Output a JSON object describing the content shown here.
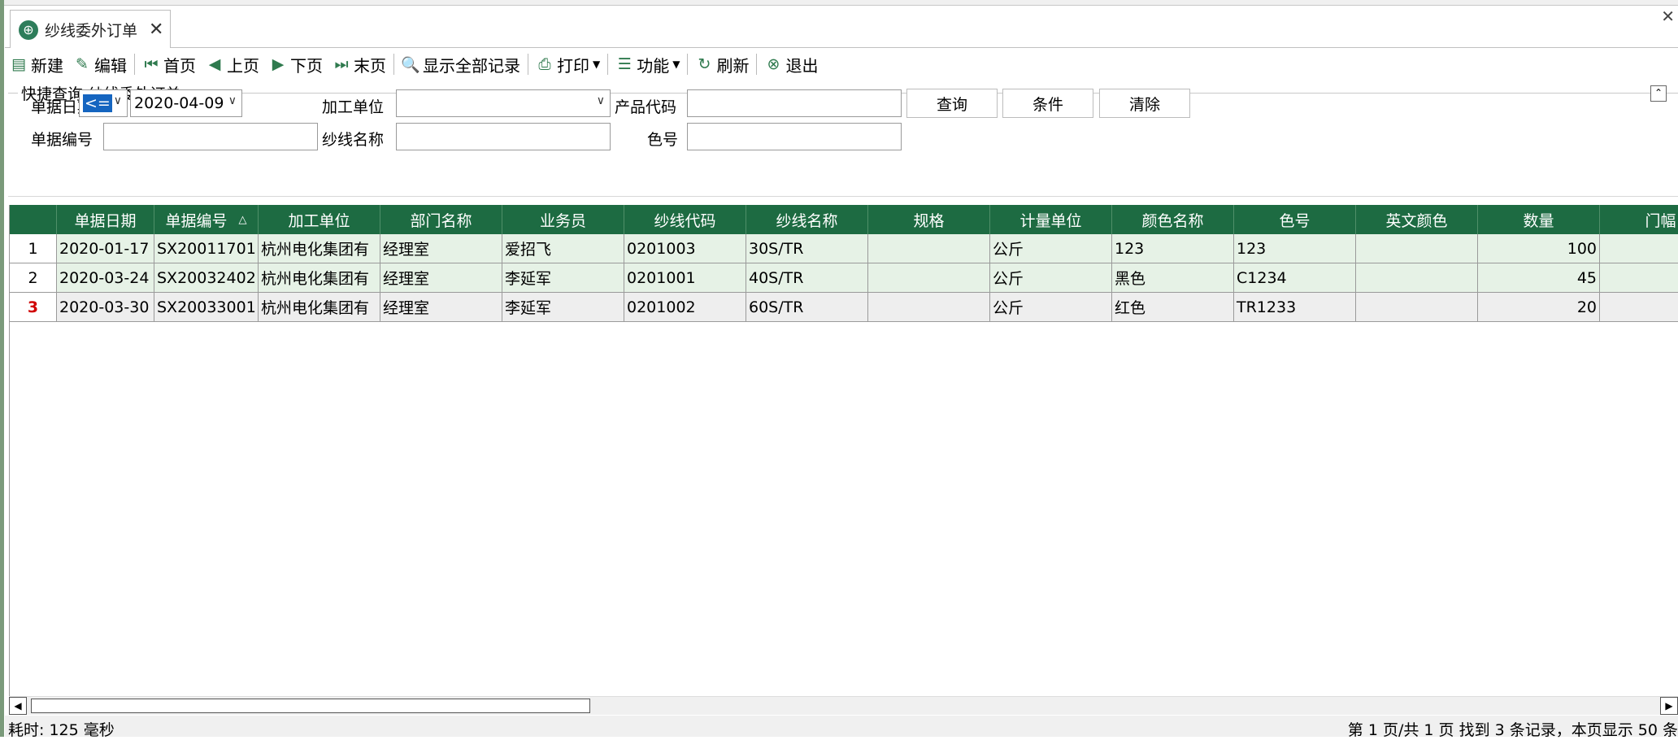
{
  "tab": {
    "title": "纱线委外订单",
    "close": "✕"
  },
  "window_close": "✕",
  "toolbar": [
    {
      "name": "new-button",
      "icon": "▤",
      "label": "新建"
    },
    {
      "name": "edit-button",
      "icon": "✎",
      "label": "编辑"
    },
    {
      "name": "first-page-button",
      "icon": "⏮",
      "label": "首页"
    },
    {
      "name": "prev-page-button",
      "icon": "◀",
      "label": "上页"
    },
    {
      "name": "next-page-button",
      "icon": "▶",
      "label": "下页"
    },
    {
      "name": "last-page-button",
      "icon": "⏭",
      "label": "末页"
    },
    {
      "name": "show-all-button",
      "icon": "🔍",
      "label": "显示全部记录"
    },
    {
      "name": "print-button",
      "icon": "⎙",
      "label": "打印"
    },
    {
      "name": "function-button",
      "icon": "☰",
      "label": "功能"
    },
    {
      "name": "refresh-button",
      "icon": "↻",
      "label": "刷新"
    },
    {
      "name": "exit-button",
      "icon": "⊗",
      "label": "退出"
    }
  ],
  "query": {
    "title": "快捷查询:纱线委外订单",
    "collapse": "⌃",
    "labels": {
      "date": "单据日期",
      "unit": "加工单位",
      "product": "产品代码",
      "doc_no": "单据编号",
      "yarn_name": "纱线名称",
      "color_no": "色号"
    },
    "operator": "<=",
    "date_value": "2020-04-09",
    "buttons": {
      "search": "查询",
      "condition": "条件",
      "clear": "清除"
    }
  },
  "grid": {
    "columns": [
      "单据日期",
      "单据编号",
      "加工单位",
      "部门名称",
      "业务员",
      "纱线代码",
      "纱线名称",
      "规格",
      "计量单位",
      "颜色名称",
      "色号",
      "英文颜色",
      "数量",
      "门幅"
    ],
    "sort_indicator": "△",
    "rows": [
      {
        "idx": "1",
        "cells": [
          "2020-01-17",
          "SX20011701",
          "杭州电化集团有",
          "经理室",
          "爱招飞",
          "0201003",
          "30S/TR",
          "",
          "公斤",
          "123",
          "123",
          "",
          "100",
          ""
        ]
      },
      {
        "idx": "2",
        "cells": [
          "2020-03-24",
          "SX20032402",
          "杭州电化集团有",
          "经理室",
          "李延军",
          "0201001",
          "40S/TR",
          "",
          "公斤",
          "黑色",
          "C1234",
          "",
          "45",
          ""
        ]
      },
      {
        "idx": "3",
        "cells": [
          "2020-03-30",
          "SX20033001",
          "杭州电化集团有",
          "经理室",
          "李延军",
          "0201002",
          "60S/TR",
          "",
          "公斤",
          "红色",
          "TR1233",
          "",
          "20",
          ""
        ]
      }
    ]
  },
  "status": {
    "left": "耗时: 125 毫秒",
    "right": "第 1 页/共 1 页 找到 3 条记录，本页显示 50 条"
  },
  "colors": {
    "header": "#1d6b42",
    "row_alt": "#e6f2e6",
    "selected_row": "#eeeeee"
  }
}
